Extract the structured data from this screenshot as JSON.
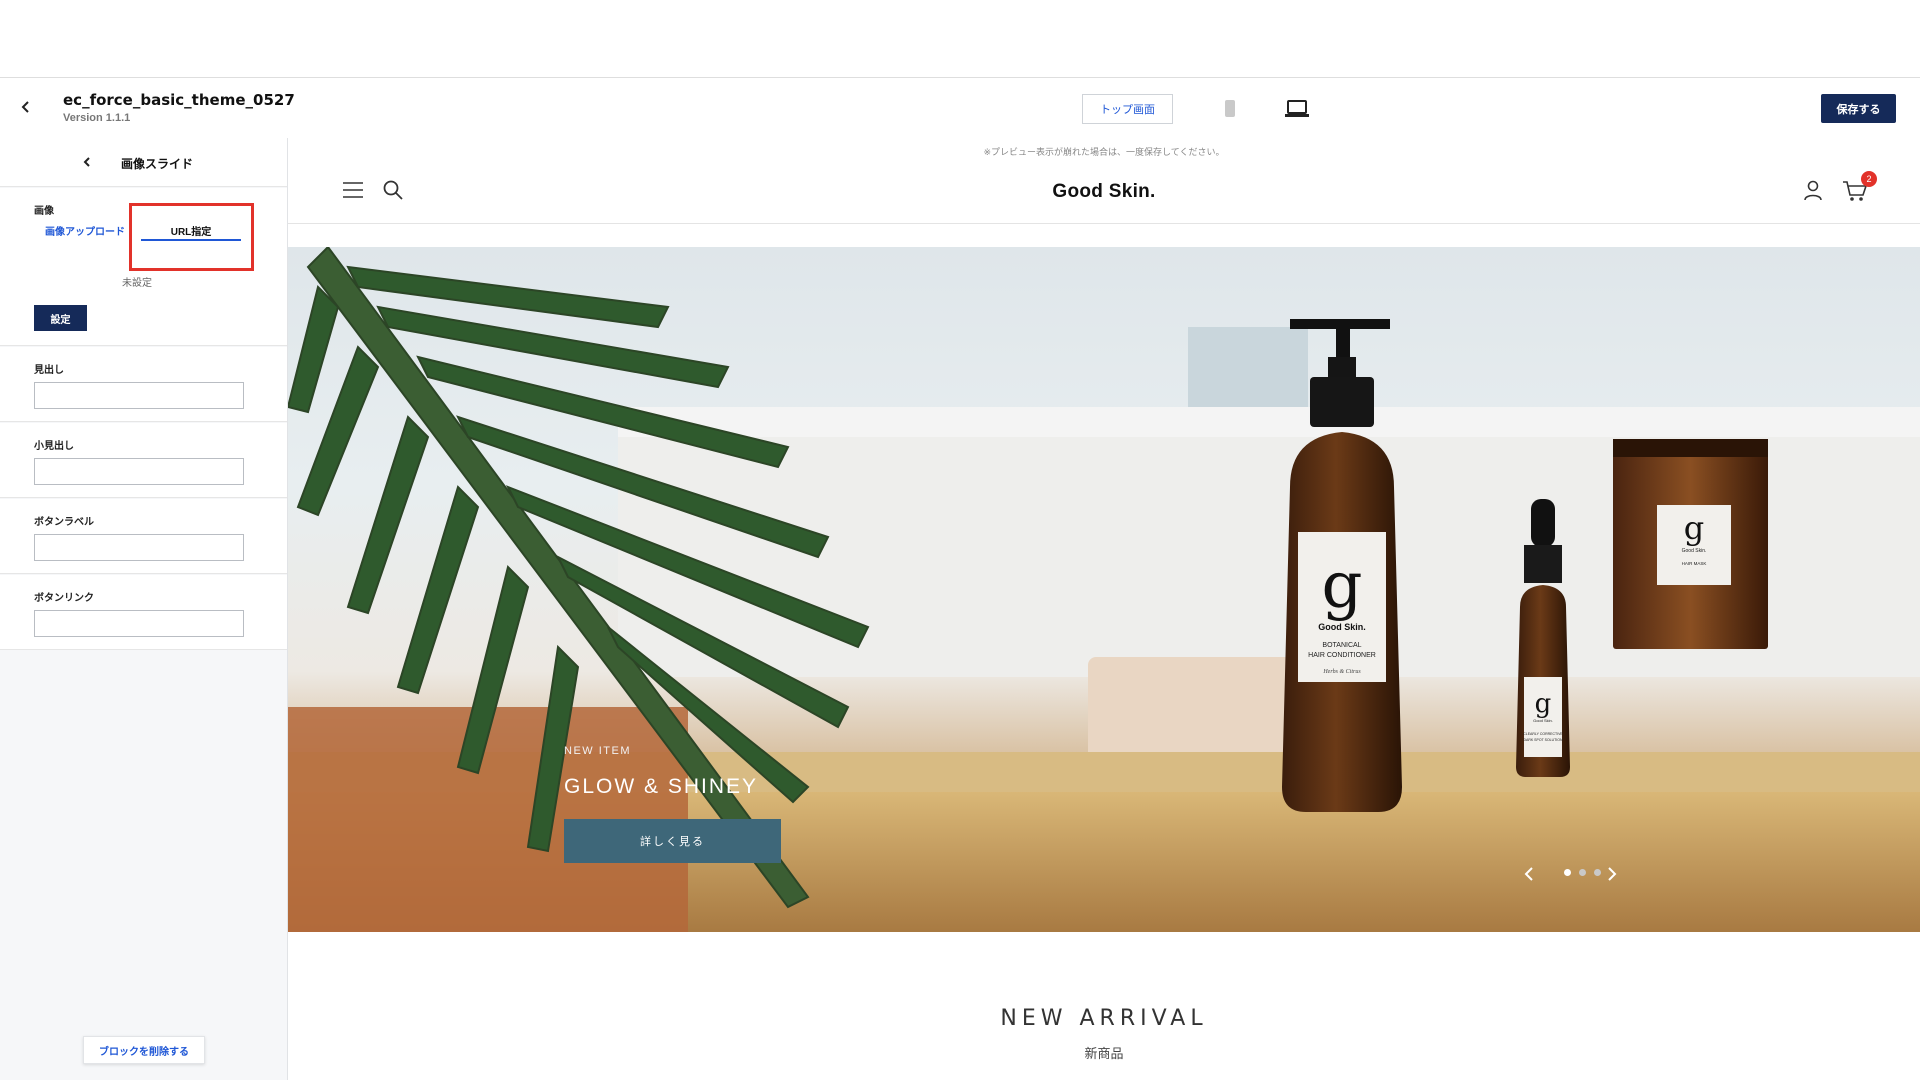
{
  "header": {
    "theme_name": "ec_force_basic_theme_0527",
    "version": "Version 1.1.1",
    "page_select": "トップ画面",
    "save_label": "保存する"
  },
  "sidebar": {
    "title": "画像スライド",
    "image_section": {
      "label": "画像",
      "tabs": [
        "画像アップロード",
        "URL指定"
      ],
      "active_tab": "URL指定",
      "status": "未設定",
      "set_button": "設定"
    },
    "fields": [
      {
        "label": "見出し",
        "value": ""
      },
      {
        "label": "小見出し",
        "value": ""
      },
      {
        "label": "ボタンラベル",
        "value": ""
      },
      {
        "label": "ボタンリンク",
        "value": ""
      }
    ],
    "delete_label": "ブロックを削除する"
  },
  "preview": {
    "note": "※プレビュー表示が崩れた場合は、一度保存してください。",
    "brand": "Good Skin.",
    "cart_count": "2",
    "hero": {
      "item_label": "NEW ITEM",
      "title": "GLOW & SHINEY",
      "button": "詳しく見る",
      "slides_total": 3,
      "active_slide": 1,
      "product_label_brand": "Good Skin.",
      "product_large_label_1": "BOTANICAL",
      "product_large_label_2": "HAIR CONDITIONER",
      "product_large_label_3": "Herbs & Citrus",
      "product_jar_label": "HAIR MASK",
      "product_dropper_label_1": "CLEARLY CORRECTIVE",
      "product_dropper_label_2": "DARK SPOT SOLUTION"
    },
    "section_title": "NEW ARRIVAL",
    "section_sub": "新商品"
  },
  "colors": {
    "accent": "#1f57d6",
    "primary_button": "#152a59",
    "highlight": "#e2322a",
    "hero_button": "#3e6779"
  }
}
